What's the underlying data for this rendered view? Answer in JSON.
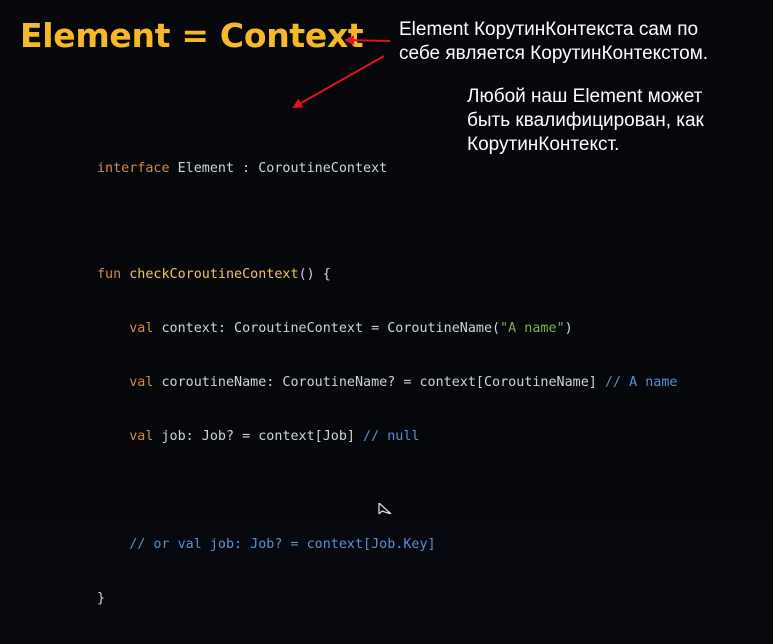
{
  "slide": {
    "title": "Element = Context",
    "annotation_1": {
      "line1": "Element КорутинКонтекста сам по",
      "line2": "себе является КорутинКонтекстом."
    },
    "annotation_2": {
      "line1": "Любой наш Element может",
      "line2": "быть квалифицирован, как",
      "line3": "КорутинКонтекст."
    },
    "colors": {
      "background": "#06070b",
      "title": "#f7b828",
      "arrow": "#e0141b",
      "keyword": "#d08a45",
      "function": "#f1c45a",
      "string": "#7fae5a",
      "comment": "#5b8ed1",
      "code_text": "#cfd3dc"
    }
  },
  "code": {
    "interface_line": {
      "kw": "interface",
      "rest": " Element : CoroutineContext"
    },
    "fun_block": {
      "l1_kw": "fun",
      "l1_fn": " checkCoroutineContext",
      "l1_rest": "() {",
      "l2_kw": "    val",
      "l2_rest": " context: CoroutineContext = CoroutineName(",
      "l2_str": "\"A name\"",
      "l2_end": ")",
      "l3_kw": "    val",
      "l3_rest": " coroutineName: CoroutineName? = context[CoroutineName] ",
      "l3_cm": "// A name",
      "l4_kw": "    val",
      "l4_rest": " job: Job? = context[Job] ",
      "l4_cm": "// null",
      "l6_cm": "    // or val job: Job? = context[Job.Key]",
      "l7": "}"
    }
  },
  "icons": {
    "arrow_to_title": "red-arrow-left",
    "arrow_to_code": "red-arrow-down-left",
    "cursor": "mouse-pointer-icon"
  }
}
